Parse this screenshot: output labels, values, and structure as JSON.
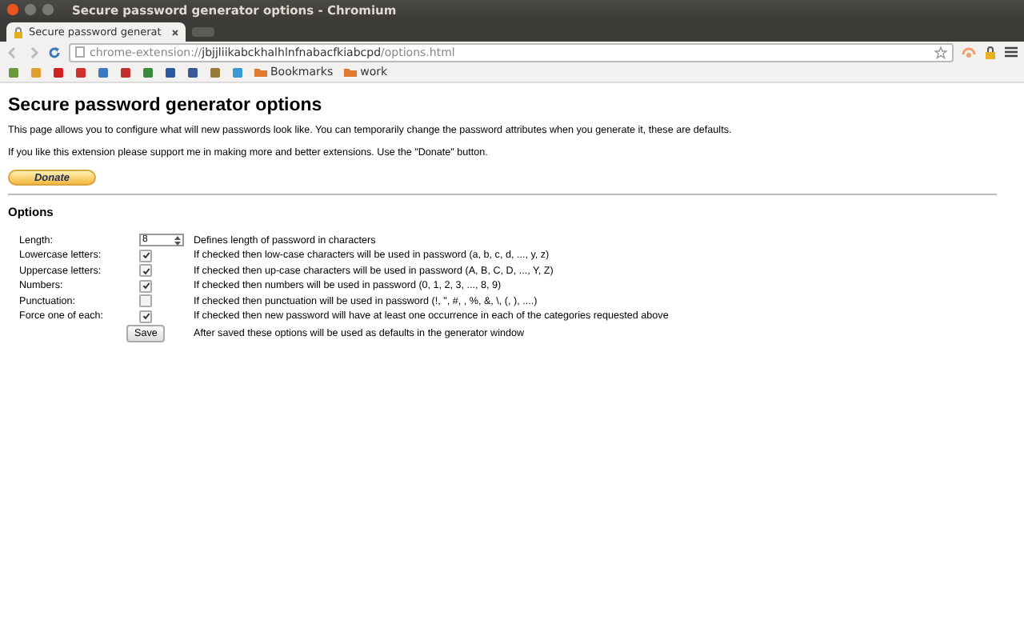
{
  "window": {
    "title": "Secure password generator options - Chromium"
  },
  "tabs": [
    {
      "label": "Secure password generat",
      "selected": true
    }
  ],
  "address_bar": {
    "url_dim": "chrome-extension://",
    "url": "jbjjliikabckhalhlnfnabacfkiabcpd",
    "url_rest": "/options.html"
  },
  "bookmarks": [
    {
      "label": "Bookmarks"
    },
    {
      "label": "work"
    }
  ],
  "page": {
    "heading": "Secure password generator options",
    "intro": "This page allows you to configure what will new passwords look like. You can temporarily change the password attributes when you generate it, these are defaults.",
    "support": "If you like this extension please support me in making more and better extensions. Use the \"Donate\" button.",
    "donate_button": "Donate",
    "options_heading": "Options",
    "options": [
      {
        "kind": "number",
        "label": "Length:",
        "value": "8",
        "description": "Defines length of password in characters"
      },
      {
        "kind": "checkbox",
        "label": "Lowercase letters:",
        "checked": true,
        "description": "If checked then low-case characters will be used in password (a, b, c, d, ..., y, z)"
      },
      {
        "kind": "checkbox",
        "label": "Uppercase letters:",
        "checked": true,
        "description": "If checked then up-case characters will be used in password (A, B, C, D, ..., Y, Z)"
      },
      {
        "kind": "checkbox",
        "label": "Numbers:",
        "checked": true,
        "description": "If checked then numbers will be used in password (0, 1, 2, 3, ..., 8, 9)"
      },
      {
        "kind": "checkbox",
        "label": "Punctuation:",
        "checked": false,
        "description": "If checked then punctuation will be used in password (!, \", #, , %, &, \\, (, ), ....)"
      },
      {
        "kind": "checkbox",
        "label": "Force one of each:",
        "checked": true,
        "description": "If checked then new password will have at least one occurrence in each of the categories requested above"
      }
    ],
    "save_button": "Save",
    "save_note": "After saved these options will be used as defaults in the generator window"
  }
}
